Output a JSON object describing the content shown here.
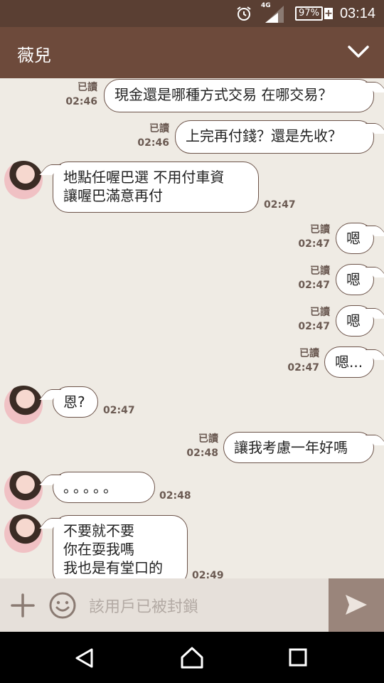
{
  "status": {
    "network": "4G",
    "battery": "97%",
    "time": "03:14"
  },
  "header": {
    "title": "薇兒"
  },
  "messages": [
    {
      "dir": "out",
      "text": "現金還是哪種方式交易  在哪交易？",
      "read": "已讀",
      "time": "02:46"
    },
    {
      "dir": "out",
      "text": "上完再付錢？還是先收？",
      "read": "已讀",
      "time": "02:46"
    },
    {
      "dir": "in",
      "text": "地點任喔巴選  不用付車資\n讓喔巴滿意再付",
      "time": "02:47"
    },
    {
      "dir": "out",
      "text": "嗯",
      "read": "已讀",
      "time": "02:47"
    },
    {
      "dir": "out",
      "text": "嗯",
      "read": "已讀",
      "time": "02:47"
    },
    {
      "dir": "out",
      "text": "嗯",
      "read": "已讀",
      "time": "02:47"
    },
    {
      "dir": "out",
      "text": "嗯...",
      "read": "已讀",
      "time": "02:47"
    },
    {
      "dir": "in",
      "text": "恩?",
      "time": "02:47"
    },
    {
      "dir": "out",
      "text": "讓我考慮一年好嗎",
      "read": "已讀",
      "time": "02:48"
    },
    {
      "dir": "in",
      "text": "。。。。。",
      "time": "02:48"
    },
    {
      "dir": "in",
      "text": "不要就不要\n你在耍我嗎\n我也是有堂口的",
      "time": "02:49"
    }
  ],
  "input": {
    "placeholder": "該用戶已被封鎖"
  }
}
